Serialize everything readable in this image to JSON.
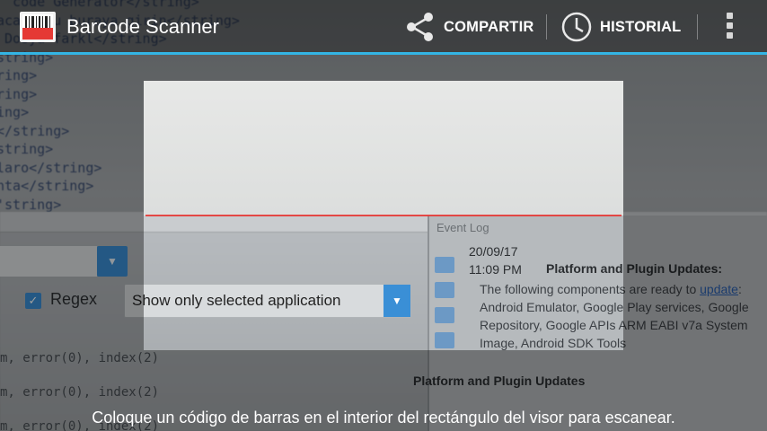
{
  "app": {
    "title": "Barcode Scanner"
  },
  "actions": {
    "share_label": "COMPARTIR",
    "history_label": "HISTORIAL"
  },
  "status_text": "Coloque un código de barras en el interior del rectángulo del visor para escanear.",
  "colors": {
    "accent": "#33b5e5",
    "laser": "#e53935"
  },
  "icons": {
    "app": "barcode-icon",
    "share": "share-icon",
    "history": "clock-icon",
    "overflow": "overflow-menu-icon"
  },
  "camera_background": {
    "code_lines": [
      "  code Generator</string>",
      "acaklodu buraya girin</string>",
      " Dosya farkl</string>",
      "string>",
      "ring>",
      "ring>",
      "ing>",
      "</string>",
      "string>",
      "laro</string>",
      "nta</string>",
      "'string>"
    ],
    "regex_label": "Regex",
    "select_label": "Show only selected application",
    "log_lines": [
      "m, error(0), index(2)",
      "m, error(0), index(2)",
      "m, error(0), index(2)"
    ],
    "event_log": {
      "header": "Event Log",
      "date": "20/09/17",
      "time": "11:09 PM",
      "title": "Platform and Plugin Updates:",
      "body_intro": "The following components are ready to",
      "body_link": "update",
      "body_rest": ": Android Emulator, Google Play services, Google Repository, Google APIs ARM EABI v7a System Image, Android SDK Tools",
      "title2": "Platform and Plugin Updates"
    }
  }
}
